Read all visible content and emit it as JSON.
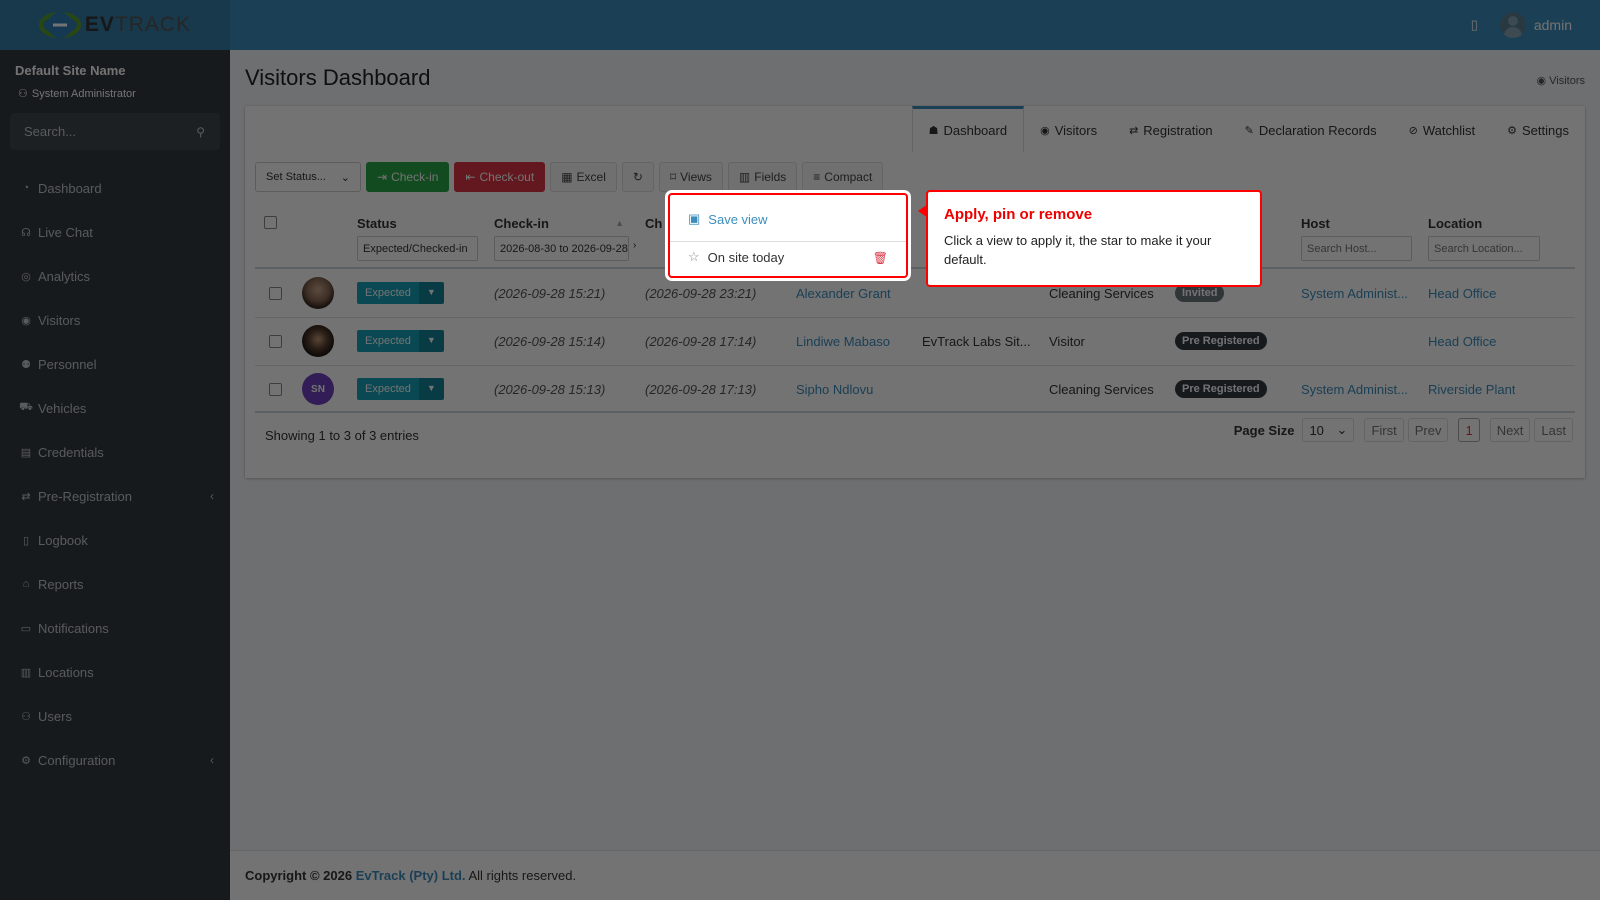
{
  "brand": {
    "name_left": "EV",
    "name_right": "TRACK"
  },
  "topbar": {
    "user": "admin"
  },
  "sidebar": {
    "site_name": "Default Site Name",
    "user_role": "System Administrator",
    "search_placeholder": "Search...",
    "items": [
      {
        "label": "Dashboard",
        "icon": "dashboard-icon"
      },
      {
        "label": "Live Chat",
        "icon": "headset-icon"
      },
      {
        "label": "Analytics",
        "icon": "analytics-icon"
      },
      {
        "label": "Visitors",
        "icon": "eye-icon"
      },
      {
        "label": "Personnel",
        "icon": "personnel-icon"
      },
      {
        "label": "Vehicles",
        "icon": "car-icon"
      },
      {
        "label": "Credentials",
        "icon": "id-card-icon"
      },
      {
        "label": "Pre-Registration",
        "icon": "exchange-icon",
        "has_submenu": true
      },
      {
        "label": "Logbook",
        "icon": "book-icon"
      },
      {
        "label": "Reports",
        "icon": "chart-icon"
      },
      {
        "label": "Notifications",
        "icon": "comment-icon"
      },
      {
        "label": "Locations",
        "icon": "building-icon"
      },
      {
        "label": "Users",
        "icon": "users-icon"
      },
      {
        "label": "Configuration",
        "icon": "gear-icon",
        "has_submenu": true
      }
    ]
  },
  "page": {
    "title": "Visitors Dashboard",
    "breadcrumb": "Visitors"
  },
  "tabs": [
    {
      "label": "Dashboard",
      "icon": "walking-icon",
      "active": true
    },
    {
      "label": "Visitors",
      "icon": "eye-icon"
    },
    {
      "label": "Registration",
      "icon": "exchange-icon"
    },
    {
      "label": "Declaration Records",
      "icon": "edit-icon"
    },
    {
      "label": "Watchlist",
      "icon": "ban-icon"
    },
    {
      "label": "Settings",
      "icon": "gear-icon"
    }
  ],
  "toolbar": {
    "set_status": "Set Status...",
    "checkin": "Check-in",
    "checkout": "Check-out",
    "excel": "Excel",
    "views": "Views",
    "fields": "Fields",
    "compact": "Compact"
  },
  "columns": {
    "status": "Status",
    "checkin": "Check-in",
    "checkout": "Ch",
    "host": "Host",
    "location": "Location"
  },
  "filters": {
    "status": "Expected/Checked-in",
    "checkin": "2026-08-30 to 2026-09-28",
    "host_placeholder": "Search Host...",
    "location_placeholder": "Search Location..."
  },
  "rows": [
    {
      "status": "Expected",
      "checkin": "(2026-09-28 15:21)",
      "checkout": "(2026-09-28 23:21)",
      "name": "Alexander Grant",
      "company": "",
      "type": "Cleaning Services",
      "badge": "Invited",
      "host": "System Administ...",
      "location": "Head Office"
    },
    {
      "status": "Expected",
      "checkin": "(2026-09-28 15:14)",
      "checkout": "(2026-09-28 17:14)",
      "name": "Lindiwe Mabaso",
      "company": "EvTrack Labs Sit...",
      "type": "Visitor",
      "badge": "Pre Registered",
      "host": "",
      "location": "Head Office"
    },
    {
      "status": "Expected",
      "checkin": "(2026-09-28 15:13)",
      "checkout": "(2026-09-28 17:13)",
      "name": "Sipho Ndlovu",
      "company": "",
      "type": "Cleaning Services",
      "badge": "Pre Registered",
      "host": "System Administ...",
      "location": "Riverside Plant",
      "initials": "SN"
    }
  ],
  "table_info": "Showing 1 to 3 of 3 entries",
  "pagination": {
    "page_size_label": "Page Size",
    "page_size": "10",
    "first": "First",
    "prev": "Prev",
    "current": "1",
    "next": "Next",
    "last": "Last"
  },
  "views_menu": {
    "save_view": "Save view",
    "saved_view": "On site today"
  },
  "tooltip": {
    "title": "Apply, pin or remove",
    "body": "Click a view to apply it, the star to make it your default."
  },
  "footer": {
    "copyright": "Copyright © 2026",
    "company": "EvTrack (Pty) Ltd.",
    "rights": "All rights reserved."
  }
}
